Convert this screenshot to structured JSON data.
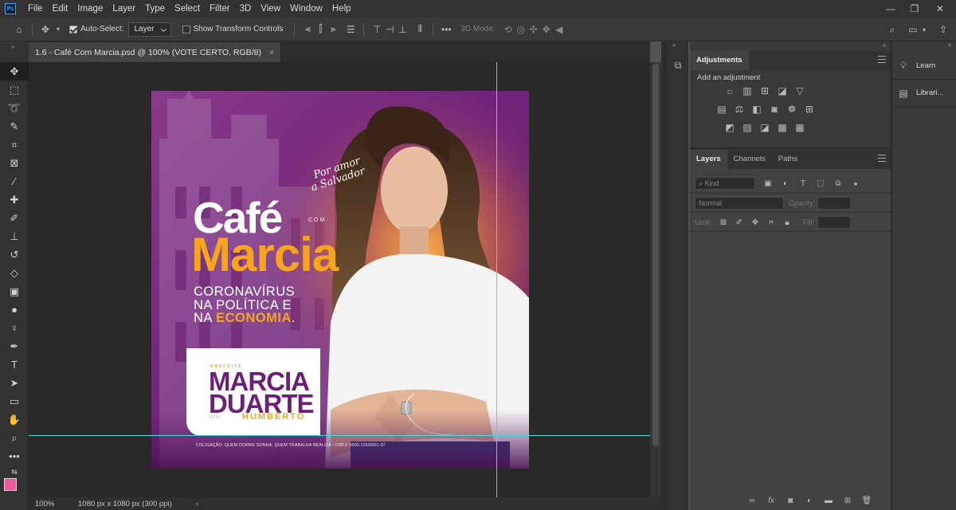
{
  "menubar": {
    "logo": "Ps",
    "items": [
      "File",
      "Edit",
      "Image",
      "Layer",
      "Type",
      "Select",
      "Filter",
      "3D",
      "View",
      "Window",
      "Help"
    ],
    "window_controls": [
      "minimize-icon",
      "maximize-icon",
      "close-icon"
    ]
  },
  "options": {
    "auto_select_label": "Auto-Select:",
    "auto_select_checked": true,
    "layer_select": "Layer",
    "show_transform_label": "Show Transform Controls",
    "show_transform_checked": false,
    "mode_3d_label": "3D Mode:"
  },
  "document": {
    "tab_title": "1.6 - Café Com Marcia.psd @ 100% (VOTE CERTO, RGB/8)",
    "close": "×"
  },
  "status": {
    "zoom": "100%",
    "info": "1080 px x 1080 px (300 ppi)",
    "arrow": "›"
  },
  "artwork": {
    "script_line1": "Por amor",
    "script_line2": "a Salvador",
    "title_top": "Café",
    "title_com": "COM",
    "title_bottom": "Marcia",
    "sub1": "CORONAVÍRUS",
    "sub2": "NA POLÍTICA E",
    "sub3_a": "NA ",
    "sub3_b": "ECONOMIA",
    "sub3_c": ".",
    "card_small": "PREFEITA",
    "card_name1": "MARCIA",
    "card_name2": "DUARTE",
    "card_vice_pre": "VICE",
    "card_vice": "HUMBERTO",
    "footer": "COLIGAÇÃO: QUEM DORME SONHA, QUEM TRABALHA REALIZA   •   CNPJ: 0000.125/0001-37"
  },
  "panels": {
    "adjustments_tab": "Adjustments",
    "add_adjustment": "Add an adjustment",
    "layers_tab": "Layers",
    "channels_tab": "Channels",
    "paths_tab": "Paths",
    "kind_placeholder": "Kind",
    "blend_mode": "Normal",
    "opacity_label": "Opacity:",
    "lock_label": "Lock:",
    "fill_label": "Fill:"
  },
  "right": {
    "learn": "Learn",
    "libraries": "Librari..."
  },
  "colors": {
    "foreground": "#e85a9a",
    "background": "#f08fc0",
    "guide": "#38e0e0",
    "accent_orange": "#f7a51c",
    "purple": "#6c1f77"
  }
}
